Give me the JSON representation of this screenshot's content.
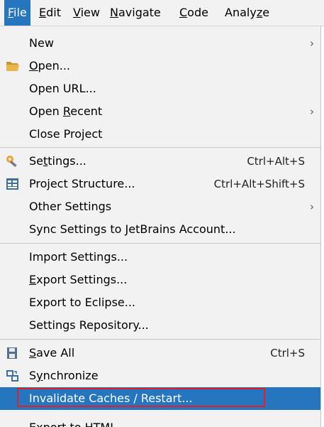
{
  "menubar": {
    "items": [
      {
        "pre": "",
        "mn": "F",
        "post": "ile"
      },
      {
        "pre": "",
        "mn": "E",
        "post": "dit"
      },
      {
        "pre": "",
        "mn": "V",
        "post": "iew"
      },
      {
        "pre": "",
        "mn": "N",
        "post": "avigate"
      },
      {
        "pre": "",
        "mn": "C",
        "post": "ode"
      },
      {
        "pre": "Analy",
        "mn": "z",
        "post": "e"
      }
    ]
  },
  "menu": {
    "new": {
      "pre": "New",
      "mn": "",
      "post": ""
    },
    "open": {
      "pre": "",
      "mn": "O",
      "post": "pen..."
    },
    "open_url": {
      "pre": "Open URL...",
      "mn": "",
      "post": ""
    },
    "open_recent": {
      "pre": "Open ",
      "mn": "R",
      "post": "ecent"
    },
    "close_project": {
      "pre": "Close Project",
      "mn": "",
      "post": ""
    },
    "settings": {
      "pre": "Se",
      "mn": "t",
      "post": "tings...",
      "shortcut": "Ctrl+Alt+S"
    },
    "project_structure": {
      "pre": "Project Structure...",
      "mn": "",
      "post": "",
      "shortcut": "Ctrl+Alt+Shift+S"
    },
    "other_settings": {
      "pre": "Other Settings",
      "mn": "",
      "post": ""
    },
    "sync_settings": {
      "pre": "Sync Settings to JetBrains Account...",
      "mn": "",
      "post": ""
    },
    "import_settings": {
      "pre": "Import Settings...",
      "mn": "",
      "post": ""
    },
    "export_settings": {
      "pre": "",
      "mn": "E",
      "post": "xport Settings..."
    },
    "export_eclipse": {
      "pre": "Export to Eclipse...",
      "mn": "",
      "post": ""
    },
    "settings_repository": {
      "pre": "Settings Repository...",
      "mn": "",
      "post": ""
    },
    "save_all": {
      "pre": "",
      "mn": "S",
      "post": "ave All",
      "shortcut": "Ctrl+S"
    },
    "synchronize": {
      "pre": "S",
      "mn": "y",
      "post": "nchronize"
    },
    "invalidate": {
      "pre": "Invalidate Caches / Restart...",
      "mn": "",
      "post": ""
    },
    "export_html_partial": {
      "pre": "Export to HTML...",
      "mn": "",
      "post": ""
    }
  },
  "icons": {
    "submenu_arrow": "chevron-right-icon",
    "open": "folder-open-icon",
    "settings": "wrench-icon",
    "project_structure": "project-structure-icon",
    "save_all": "floppy-disk-icon",
    "synchronize": "sync-icon"
  },
  "colors": {
    "selection": "#2675bf",
    "highlight_box": "#e0202a",
    "menu_bg": "#f2f2f2",
    "folder": "#e8b64a"
  }
}
